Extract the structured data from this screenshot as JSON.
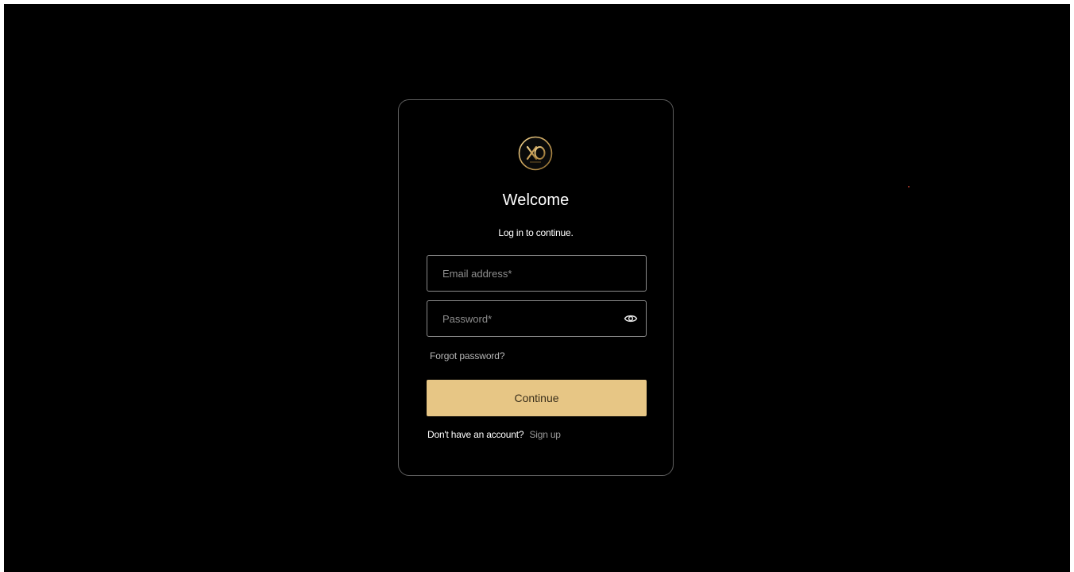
{
  "login": {
    "logo_text": "XO",
    "title": "Welcome",
    "subtitle": "Log in to continue.",
    "email": {
      "value": "",
      "placeholder": "Email address*"
    },
    "password": {
      "value": "",
      "placeholder": "Password*",
      "toggle_icon": "eye-icon"
    },
    "forgot_label": "Forgot password?",
    "continue_label": "Continue",
    "signup_prompt": "Don't have an account?",
    "signup_label": "Sign up"
  },
  "colors": {
    "background": "#000000",
    "card_border": "#5e5e5e",
    "field_border": "#8a8a8a",
    "accent": "#e7c685",
    "logo_gold": "#c9a15a"
  }
}
